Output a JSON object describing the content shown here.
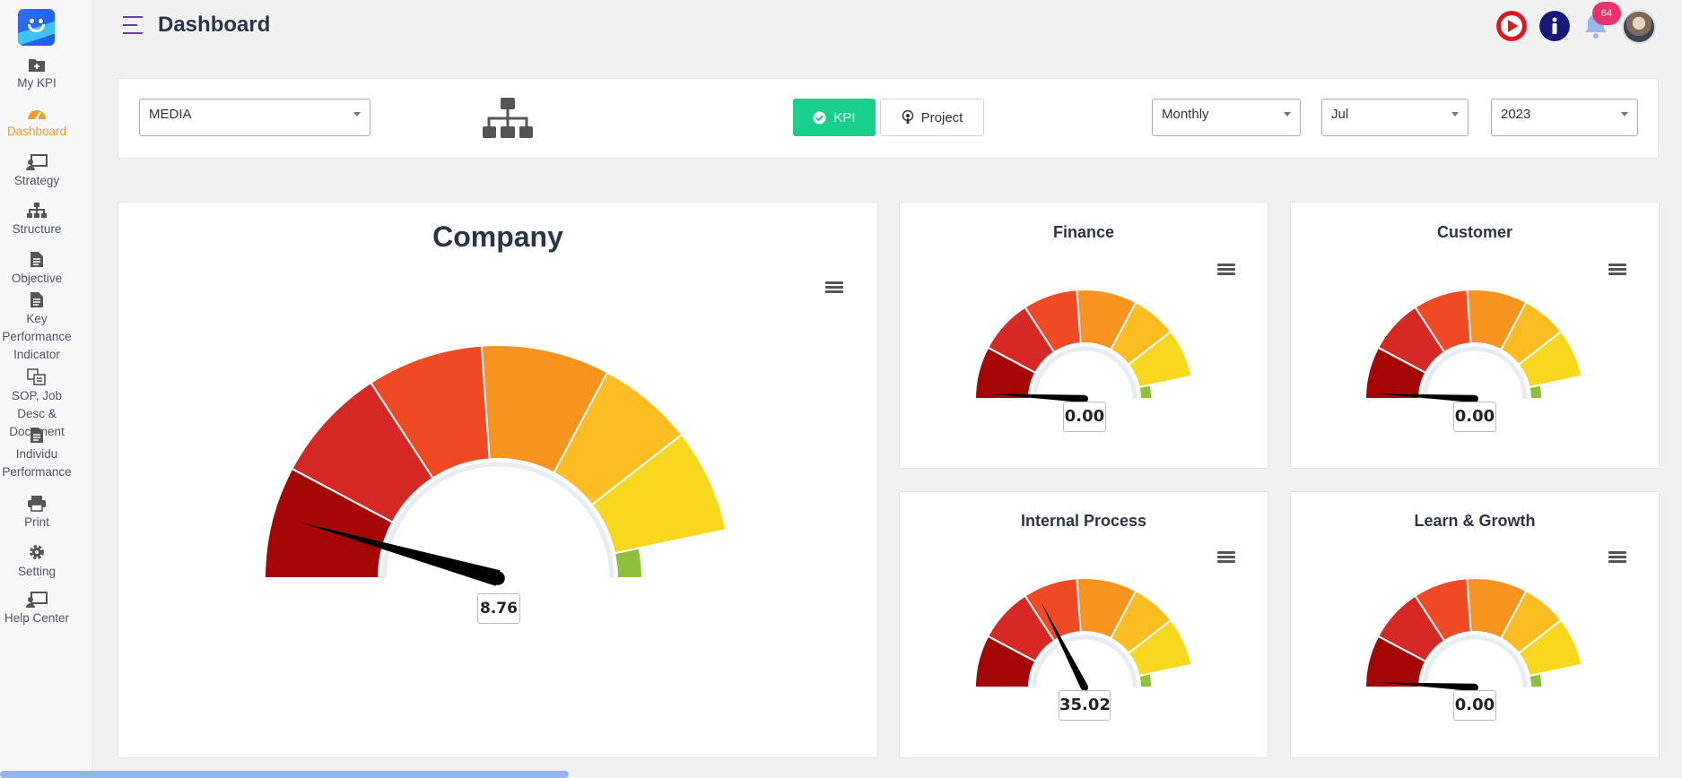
{
  "app": {
    "page_title": "Dashboard",
    "notification_count": "64"
  },
  "sidebar": {
    "items": [
      {
        "label": "My KPI",
        "icon": "folder-plus-icon"
      },
      {
        "label": "Dashboard",
        "icon": "speedometer-icon",
        "active": true
      },
      {
        "label": "Strategy",
        "icon": "presentation-icon"
      },
      {
        "label": "Structure",
        "icon": "org-chart-icon"
      },
      {
        "label": "Objective",
        "icon": "document-icon"
      },
      {
        "label": "Key Performance Indicator",
        "icon": "document-icon"
      },
      {
        "label": "SOP, Job Desc & Document",
        "icon": "copy-icon"
      },
      {
        "label": "Individu Performance",
        "icon": "document-icon"
      },
      {
        "label": "Print",
        "icon": "printer-icon"
      },
      {
        "label": "Setting",
        "icon": "gear-icon"
      },
      {
        "label": "Help Center",
        "icon": "presentation-icon"
      }
    ]
  },
  "filters": {
    "department": "MEDIA",
    "kpi_label": "KPI",
    "project_label": "Project",
    "period": "Monthly",
    "month": "Jul",
    "year": "2023"
  },
  "gauges": {
    "company": {
      "title": "Company",
      "value": 8.76,
      "value_text": "8.76"
    },
    "finance": {
      "title": "Finance",
      "value": 0,
      "value_text": "0.00"
    },
    "customer": {
      "title": "Customer",
      "value": 0,
      "value_text": "0.00"
    },
    "internal": {
      "title": "Internal Process",
      "value": 35.02,
      "value_text": "35.02"
    },
    "learn": {
      "title": "Learn & Growth",
      "value": 0,
      "value_text": "0.00"
    }
  },
  "gauge_scale": {
    "min": 0,
    "max": 100
  },
  "colors": {
    "bands": [
      "#a50707",
      "#d62825",
      "#f04a25",
      "#f7931f",
      "#fbbd21",
      "#f8d81f",
      "#8fc03c"
    ],
    "accent": "#18cf8c",
    "active_nav": "#f09c28"
  }
}
